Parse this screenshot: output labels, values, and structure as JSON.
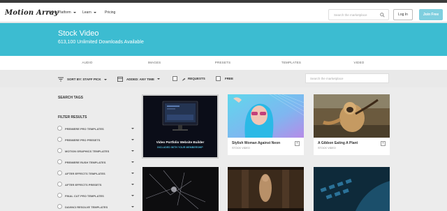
{
  "header": {
    "logo": "Motion Array",
    "nav": [
      {
        "label": "Video Platform",
        "dropdown": true
      },
      {
        "label": "Learn",
        "dropdown": true
      },
      {
        "label": "Pricing",
        "dropdown": false
      }
    ],
    "search_placeholder": "Search the marketplace",
    "login_label": "Log In",
    "join_label": "Join Free"
  },
  "hero": {
    "title": "Stock Video",
    "subtitle": "613,100 Unlimited Downloads Available",
    "color": "#3cbcd1"
  },
  "categories": [
    "Audio",
    "Images",
    "Presets",
    "Templates",
    "Video"
  ],
  "filters": {
    "sort_label": "SORT BY: STAFF PICK",
    "added_label": "ADDED: ANY TIME",
    "requests_label": "REQUESTS",
    "free_label": "FREE",
    "search_placeholder": "Search the marketplace"
  },
  "sidebar": {
    "search_tags": "Search Tags",
    "filter_results": "Filter Results",
    "items": [
      "Premiere Pro Templates",
      "Premiere Pro Presets",
      "Motion Graphics Templates",
      "Premiere Rush Templates",
      "After Effects Templates",
      "After Effects Presets",
      "Final Cut Pro Templates",
      "DaVinci Resolve Templates"
    ]
  },
  "cards": [
    {
      "title": "Video Portfolio Website Builder",
      "subtitle": "INCLUDED WITH YOUR MEMBERSHIP",
      "type": "promo"
    },
    {
      "title": "Stylish Woman Against Neon",
      "subtitle": "Stock Video",
      "type": "video"
    },
    {
      "title": "A Gibbon Eating A Plant",
      "subtitle": "Stock Video",
      "type": "video"
    }
  ],
  "icons": {
    "search": "search-icon",
    "sort": "sort-icon",
    "calendar": "calendar-icon",
    "request": "request-icon",
    "add": "add-to-collection-icon"
  }
}
